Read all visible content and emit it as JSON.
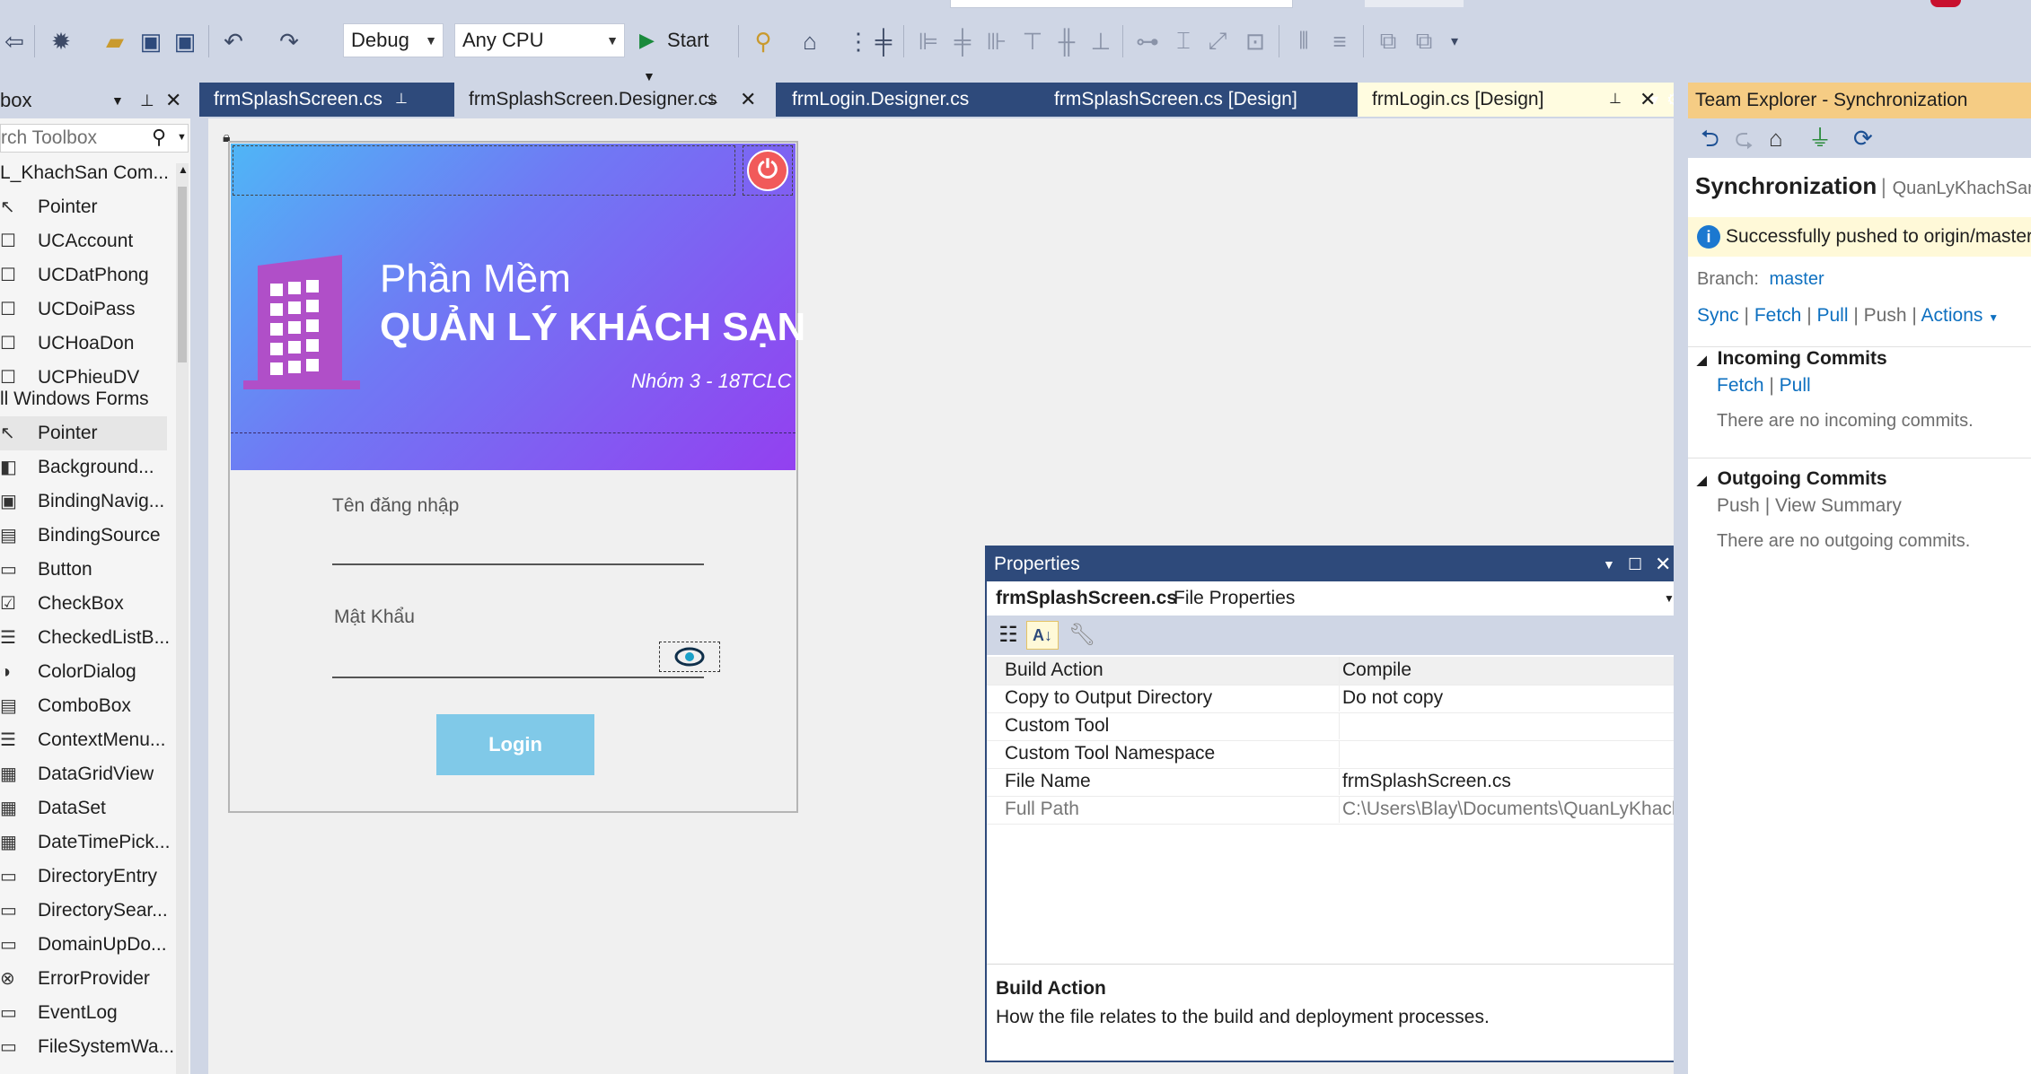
{
  "toolbar": {
    "configuration": "Debug",
    "platform": "Any CPU",
    "start_label": "Start"
  },
  "toolbox": {
    "title": "box",
    "search_placeholder": "rch Toolbox",
    "group_project": "L_KhachSan Com...",
    "project_items": [
      "Pointer",
      "UCAccount",
      "UCDatPhong",
      "UCDoiPass",
      "UCHoaDon",
      "UCPhieuDV"
    ],
    "group_forms": "ll Windows Forms",
    "form_items": [
      "Pointer",
      "Background...",
      "BindingNavig...",
      "BindingSource",
      "Button",
      "CheckBox",
      "CheckedListB...",
      "ColorDialog",
      "ComboBox",
      "ContextMenu...",
      "DataGridView",
      "DataSet",
      "DateTimePick...",
      "DirectoryEntry",
      "DirectorySear...",
      "DomainUpDo...",
      "ErrorProvider",
      "EventLog",
      "FileSystemWa..."
    ]
  },
  "tabs": [
    {
      "label": "frmSplashScreen.cs"
    },
    {
      "label": "frmSplashScreen.Designer.cs"
    },
    {
      "label": "frmLogin.Designer.cs"
    },
    {
      "label": "frmSplashScreen.cs [Design]"
    },
    {
      "label": "frmLogin.cs [Design]"
    }
  ],
  "form": {
    "title_line1": "Phần Mềm",
    "title_line2": "QUẢN LÝ KHÁCH SẠN",
    "subtitle": "Nhóm 3 - 18TCLC",
    "username_label": "Tên đăng nhập",
    "password_label": "Mật Khẩu",
    "login_label": "Login"
  },
  "properties": {
    "title": "Properties",
    "object_name": "frmSplashScreen.cs",
    "object_type": "File Properties",
    "rows": [
      {
        "name": "Build Action",
        "value": "Compile"
      },
      {
        "name": "Copy to Output Directory",
        "value": "Do not copy"
      },
      {
        "name": "Custom Tool",
        "value": ""
      },
      {
        "name": "Custom Tool Namespace",
        "value": ""
      },
      {
        "name": "File Name",
        "value": "frmSplashScreen.cs"
      },
      {
        "name": "Full Path",
        "value": "C:\\Users\\Blay\\Documents\\QuanLyKhachSa"
      }
    ],
    "desc_title": "Build Action",
    "desc_text": "How the file relates to the build and deployment processes."
  },
  "team_explorer": {
    "title": "Team Explorer - Synchronization",
    "heading": "Synchronization",
    "repo": "QuanLyKhachSan",
    "info": "Successfully pushed to origin/master",
    "branch_label": "Branch:",
    "branch": "master",
    "actions": [
      "Sync",
      "Fetch",
      "Pull",
      "Push",
      "Actions"
    ],
    "incoming_title": "Incoming Commits",
    "incoming_links": [
      "Fetch",
      "Pull"
    ],
    "incoming_empty": "There are no incoming commits.",
    "outgoing_title": "Outgoing Commits",
    "outgoing_links": [
      "Push",
      "View Summary"
    ],
    "outgoing_empty": "There are no outgoing commits."
  },
  "colors": {
    "tab_bar": "#2e4a7b",
    "active_tab": "#fffce0",
    "selected_tab": "#cfd6e5",
    "team_explorer_header": "#f5cc84",
    "link": "#0e70c0",
    "login_button": "#80c9e8",
    "power_button": "#f15a5a"
  },
  "icons": [
    "new-project-icon",
    "open-icon",
    "save-icon",
    "save-all-icon",
    "undo-icon",
    "redo-icon",
    "start-icon",
    "find-icon",
    "layout-icon",
    "back-icon",
    "forward-icon",
    "home-icon",
    "plug-icon",
    "refresh-icon",
    "power-icon",
    "building-icon",
    "eye-icon",
    "categorized-icon",
    "alphabetical-icon",
    "wrench-icon",
    "info-icon"
  ]
}
